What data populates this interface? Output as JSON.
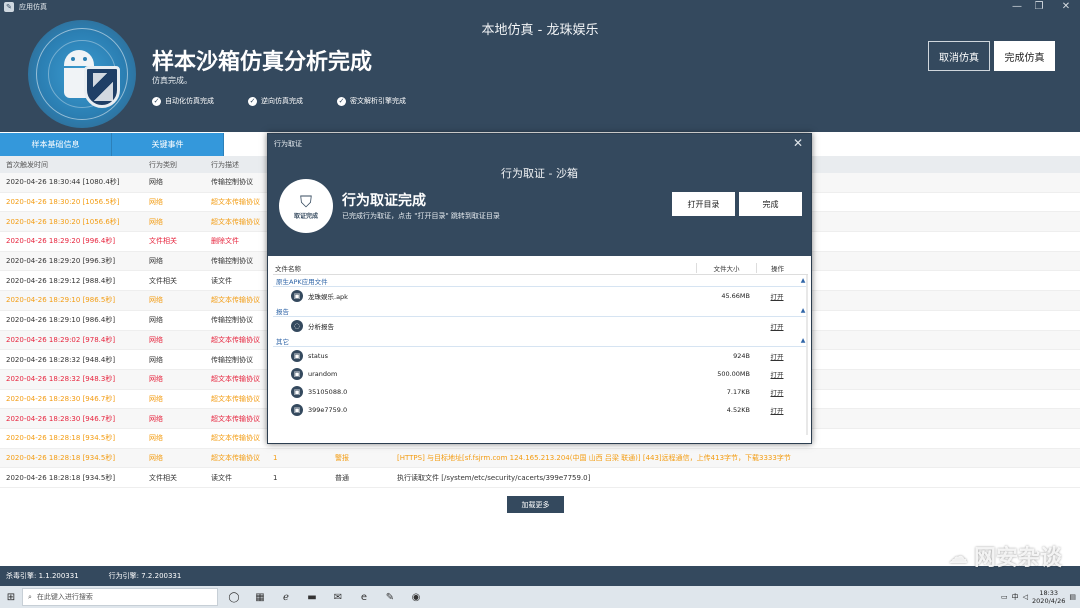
{
  "window": {
    "app_title": "应用仿真",
    "center_title": "本地仿真 - 龙珠娱乐",
    "controls": [
      "—",
      "❐",
      "✕"
    ]
  },
  "header": {
    "main_title": "样本沙箱仿真分析完成",
    "sub_title": "仿真完成。",
    "checks": [
      "自动化仿真完成",
      "逆向仿真完成",
      "密文解析引擎完成"
    ],
    "cancel_label": "取消仿真",
    "done_label": "完成仿真"
  },
  "tabs": [
    "样本基础信息",
    "关键事件"
  ],
  "table": {
    "headers": [
      "首次触发时间",
      "行为类别",
      "行为描述"
    ],
    "rows": [
      {
        "time": "2020-04-26 18:30:44 [1080.4秒]",
        "cat": "网络",
        "desc": "传输控制协议",
        "tone": "normal"
      },
      {
        "time": "2020-04-26 18:30:20 [1056.5秒]",
        "cat": "网络",
        "desc": "超文本传输协议",
        "tone": "orange"
      },
      {
        "time": "2020-04-26 18:30:20 [1056.6秒]",
        "cat": "网络",
        "desc": "超文本传输协议",
        "tone": "orange"
      },
      {
        "time": "2020-04-26 18:29:20 [996.4秒]",
        "cat": "文件相关",
        "desc": "删除文件",
        "tone": "red"
      },
      {
        "time": "2020-04-26 18:29:20 [996.3秒]",
        "cat": "网络",
        "desc": "传输控制协议",
        "tone": "normal"
      },
      {
        "time": "2020-04-26 18:29:12 [988.4秒]",
        "cat": "文件相关",
        "desc": "读文件",
        "tone": "normal"
      },
      {
        "time": "2020-04-26 18:29:10 [986.5秒]",
        "cat": "网络",
        "desc": "超文本传输协议",
        "tone": "orange"
      },
      {
        "time": "2020-04-26 18:29:10 [986.4秒]",
        "cat": "网络",
        "desc": "传输控制协议",
        "tone": "normal"
      },
      {
        "time": "2020-04-26 18:29:02 [978.4秒]",
        "cat": "网络",
        "desc": "超文本传输协议",
        "tone": "red"
      },
      {
        "time": "2020-04-26 18:28:32 [948.4秒]",
        "cat": "网络",
        "desc": "传输控制协议",
        "tone": "normal"
      },
      {
        "time": "2020-04-26 18:28:32 [948.3秒]",
        "cat": "网络",
        "desc": "超文本传输协议",
        "tone": "red"
      },
      {
        "time": "2020-04-26 18:28:30 [946.7秒]",
        "cat": "网络",
        "desc": "超文本传输协议",
        "tone": "orange"
      },
      {
        "time": "2020-04-26 18:28:30 [946.7秒]",
        "cat": "网络",
        "desc": "超文本传输协议",
        "tone": "red"
      },
      {
        "time": "2020-04-26 18:28:18 [934.5秒]",
        "cat": "网络",
        "desc": "超文本传输协议",
        "tone": "orange"
      },
      {
        "time": "2020-04-26 18:28:18 [934.5秒]",
        "cat": "网络",
        "desc": "超文本传输协议",
        "tone": "orange",
        "count": "1",
        "level": "警报",
        "detail": "[HTTPS] 与目标地址[sf.fsjrm.com 124.165.213.204(中国 山西 吕梁 联通)] [443]远程通信，上传413字节，下载3333字节"
      },
      {
        "time": "2020-04-26 18:28:18 [934.5秒]",
        "cat": "文件相关",
        "desc": "读文件",
        "tone": "normal",
        "count": "1",
        "level": "普通",
        "detail": "执行读取文件 [/system/etc/security/cacerts/399e7759.0]"
      }
    ],
    "load_more": "加载更多"
  },
  "statusbar": {
    "antivirus": "杀毒引擎: 1.1.200331",
    "behavior": "行为引擎: 7.2.200331"
  },
  "watermark": "网安杂谈",
  "taskbar": {
    "search_placeholder": "在此键入进行搜索",
    "clock_time": "18:33",
    "clock_date": "2020/4/26",
    "ime": "中"
  },
  "modal": {
    "title": "行为取证",
    "center_title": "行为取证 - 沙箱",
    "logo_text": "取证完成",
    "main": "行为取证完成",
    "sub": "已完成行为取证，点击 \"打开目录\" 跳转到取证目录",
    "open_dir": "打开目录",
    "done": "完成",
    "headers": {
      "name": "文件名称",
      "size": "文件大小",
      "action": "操作"
    },
    "groups": [
      {
        "label": "原生APK应用文件",
        "files": [
          {
            "name": "龙珠娱乐.apk",
            "size": "45.66MB",
            "action": "打开"
          }
        ]
      },
      {
        "label": "报告",
        "files": [
          {
            "name": "分析报告",
            "size": "",
            "action": "打开"
          }
        ]
      },
      {
        "label": "其它",
        "files": [
          {
            "name": "status",
            "size": "924B",
            "action": "打开"
          },
          {
            "name": "urandom",
            "size": "500.00MB",
            "action": "打开"
          },
          {
            "name": "35105088.0",
            "size": "7.17KB",
            "action": "打开"
          },
          {
            "name": "399e7759.0",
            "size": "4.52KB",
            "action": "打开"
          }
        ]
      }
    ]
  }
}
